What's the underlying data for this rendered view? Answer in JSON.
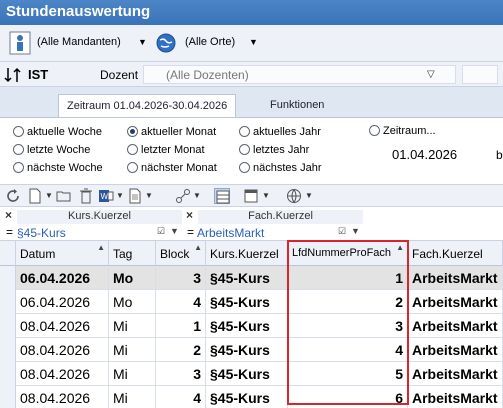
{
  "window": {
    "title": "Stundenauswertung"
  },
  "filterbar": {
    "mandanten": "(Alle Mandanten)",
    "orte": "(Alle Orte)"
  },
  "ist_row": {
    "label": "IST",
    "dozent_label": "Dozent",
    "dozent_value": "(Alle Dozenten)"
  },
  "tabs": [
    {
      "label": "Zeitraum 01.04.2026-30.04.2026",
      "active": true
    },
    {
      "label": "Funktionen",
      "active": false
    }
  ],
  "periods": {
    "col1": [
      "aktuelle Woche",
      "letzte Woche",
      "nächste Woche"
    ],
    "col2": [
      "aktueller Monat",
      "letzter Monat",
      "nächster Monat"
    ],
    "col3": [
      "aktuelles Jahr",
      "letztes Jahr",
      "nächstes Jahr"
    ],
    "custom": "Zeitraum...",
    "selected": "aktueller Monat",
    "date_from": "01.04.2026",
    "b_label": "b"
  },
  "filter_panel": {
    "kurs": {
      "title": "Kurs.Kuerzel",
      "value": "§45-Kurs",
      "eq": "="
    },
    "fach": {
      "title": "Fach.Kuerzel",
      "value": "ArbeitsMarkt",
      "eq": "="
    }
  },
  "grid": {
    "columns": [
      "Datum",
      "Tag",
      "Block",
      "Kurs.Kuerzel",
      "LfdNummerProFach",
      "Fach.Kuerzel"
    ],
    "rows": [
      {
        "datum": "06.04.2026",
        "tag": "Mo",
        "block": "3",
        "kurs": "§45-Kurs",
        "lfd": "1",
        "fach": "ArbeitsMarkt"
      },
      {
        "datum": "06.04.2026",
        "tag": "Mo",
        "block": "4",
        "kurs": "§45-Kurs",
        "lfd": "2",
        "fach": "ArbeitsMarkt"
      },
      {
        "datum": "08.04.2026",
        "tag": "Mi",
        "block": "1",
        "kurs": "§45-Kurs",
        "lfd": "3",
        "fach": "ArbeitsMarkt"
      },
      {
        "datum": "08.04.2026",
        "tag": "Mi",
        "block": "2",
        "kurs": "§45-Kurs",
        "lfd": "4",
        "fach": "ArbeitsMarkt"
      },
      {
        "datum": "08.04.2026",
        "tag": "Mi",
        "block": "3",
        "kurs": "§45-Kurs",
        "lfd": "5",
        "fach": "ArbeitsMarkt"
      },
      {
        "datum": "08.04.2026",
        "tag": "Mi",
        "block": "4",
        "kurs": "§45-Kurs",
        "lfd": "6",
        "fach": "ArbeitsMarkt"
      }
    ],
    "selected_row": 0,
    "highlighted_column": "LfdNummerProFach"
  },
  "colors": {
    "title_bar": "#3a73b8",
    "highlight": "#d8262c",
    "filter_value": "#2762b8"
  }
}
